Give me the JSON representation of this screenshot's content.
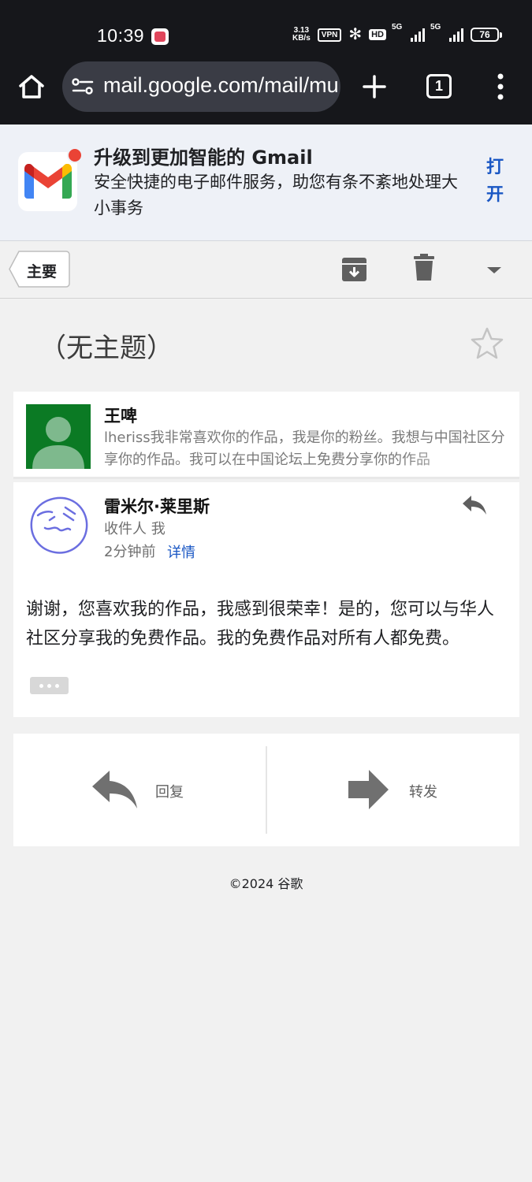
{
  "status_bar": {
    "time": "10:39",
    "net_speed_value": "3.13",
    "net_speed_unit": "KB/s",
    "vpn": "VPN",
    "hd": "HD",
    "signal_1_label": "5G",
    "signal_2_label": "5G",
    "battery": "76"
  },
  "browser": {
    "url": "mail.google.com/mail/mu",
    "tab_count": "1"
  },
  "promo": {
    "title": "升级到更加智能的 Gmail",
    "description": "安全快捷的电子邮件服务，助您有条不紊地处理大小事务",
    "open_label": "打开"
  },
  "action_bar": {
    "label": "主要"
  },
  "thread": {
    "subject": "（无主题）",
    "messages": [
      {
        "sender": "王啤",
        "snippet": "lheriss我非常喜欢你的作品，我是你的粉丝。我想与中国社区分享你的作品。我可以在中国论坛上免费分享你的作品"
      },
      {
        "sender": "雷米尔·莱里斯",
        "recipient": "收件人 我",
        "time": "2分钟前",
        "details_label": "详情",
        "body": "谢谢，您喜欢我的作品，我感到很荣幸！是的，您可以与华人社区分享我的免费作品。我的免费作品对所有人都免费。"
      }
    ]
  },
  "actions": {
    "reply_label": "回复",
    "forward_label": "转发"
  },
  "footer": {
    "copyright": "©2024 谷歌"
  },
  "colors": {
    "link_blue": "#1a57c4",
    "avatar_green": "#0b7a24",
    "dark_bar": "#16171b"
  }
}
